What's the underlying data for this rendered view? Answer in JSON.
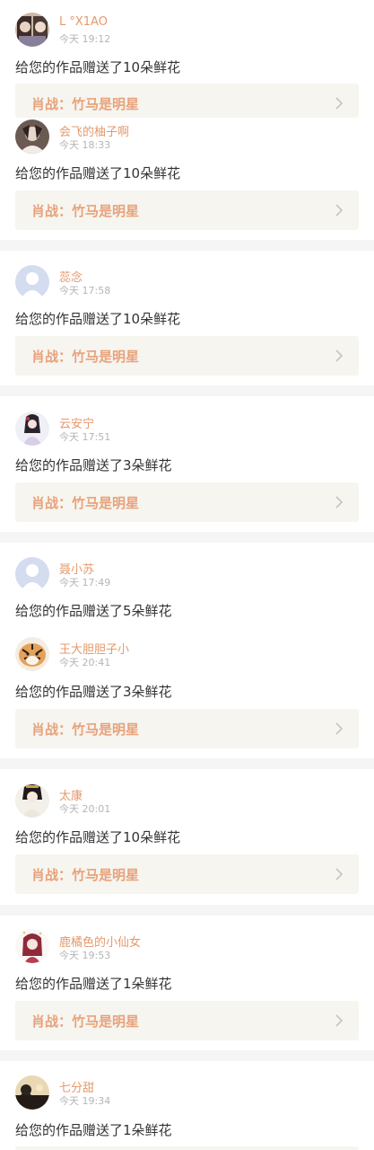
{
  "link_label": "肖战：竹马是明星",
  "items": [
    {
      "name": "L °X1AO",
      "time": "今天 19:12",
      "message": "给您的作品赠送了10朵鲜花",
      "avatar": "user-photo-avatar"
    },
    {
      "name": "会飞的柚子啊",
      "time": "今天 18:33",
      "message": "给您的作品赠送了10朵鲜花",
      "avatar": "user-photo-avatar"
    },
    {
      "name": "蕊念",
      "time": "今天 17:58",
      "message": "给您的作品赠送了10朵鲜花",
      "avatar": "default-avatar"
    },
    {
      "name": "云安宁",
      "time": "今天 17:51",
      "message": "给您的作品赠送了3朵鲜花",
      "avatar": "user-photo-avatar"
    },
    {
      "name": "聂小苏",
      "time": "今天 17:49",
      "message": "给您的作品赠送了5朵鲜花",
      "avatar": "default-avatar"
    },
    {
      "name": "王大胆胆子小",
      "time": "今天 20:41",
      "message": "给您的作品赠送了3朵鲜花",
      "avatar": "tiger-avatar"
    },
    {
      "name": "太康",
      "time": "今天 20:01",
      "message": "给您的作品赠送了10朵鲜花",
      "avatar": "user-photo-avatar"
    },
    {
      "name": "鹿橘色的小仙女",
      "time": "今天 19:53",
      "message": "给您的作品赠送了1朵鲜花",
      "avatar": "user-photo-avatar"
    },
    {
      "name": "七分甜",
      "time": "今天 19:34",
      "message": "给您的作品赠送了1朵鲜花",
      "avatar": "user-photo-avatar"
    }
  ],
  "colors": {
    "accent": "#e5996b",
    "link_bg": "#f6f5ef",
    "link_text": "#e8a27c",
    "divider": "#f5f5f5"
  }
}
